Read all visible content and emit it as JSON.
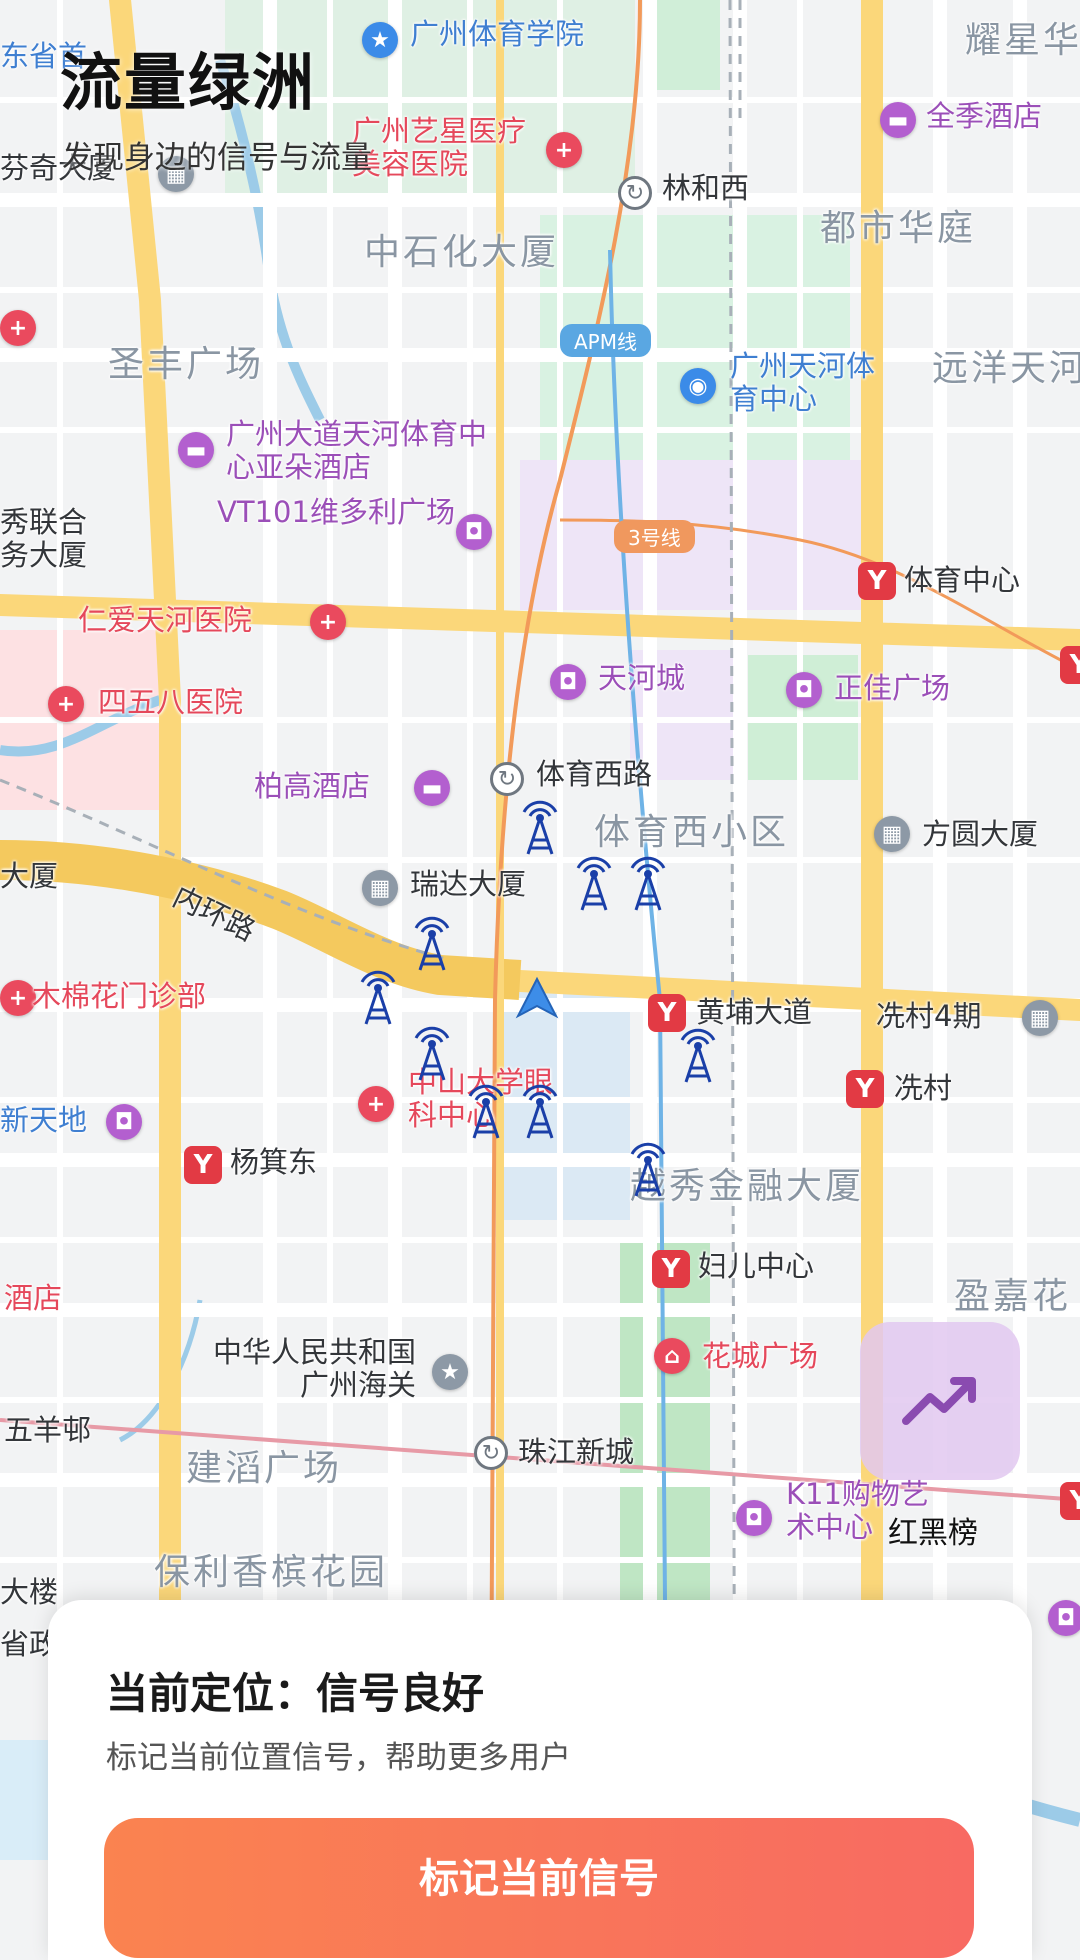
{
  "app": {
    "title": "流量绿洲",
    "subtitle": "发现身边的信号与流量"
  },
  "map": {
    "labels": {
      "guangzhou_sports_institute": "广州体育学院",
      "yaoxing": "耀星华",
      "quanji_hotel": "全季酒店",
      "yixing_hospital": "广州艺星医疗美容医院",
      "linhexi": "林和西",
      "fenqi": "芬奇大厦",
      "dongsheng": "东省首",
      "zhongshihua": "中石化大厦",
      "dushi_huating": "都市华庭",
      "apm_line": "APM线",
      "tianhe_sports_center": "广州天河体育中心",
      "yuanyang": "远洋天河",
      "shengfeng": "圣丰广场",
      "yaduo_hotel": "广州大道天河体育中心亚朵酒店",
      "vt101": "VT101维多利广场",
      "lianhe": "秀联合务大厦",
      "line3": "3号线",
      "tiyu_zhongxin": "体育中心",
      "renai_hospital": "仁爱天河医院",
      "tianhecheng": "天河城",
      "zhengjia": "正佳广场",
      "458_hospital": "四五八医院",
      "baigao_hotel": "柏高酒店",
      "tiyuxilu": "体育西路",
      "tiyuxi_xiaoqu": "体育西小区",
      "fangyuan": "方圆大厦",
      "dasha": "大厦",
      "neihuan": "内环路",
      "ruida": "瑞达大厦",
      "muchmianhua": "木棉花门诊部",
      "huangpu": "黄埔大道",
      "xiancun4": "冼村4期",
      "xiancun": "冼村",
      "zhongshan_eye": "中山大学眼科中心",
      "xintiandi": "新天地",
      "yangjidong": "杨箕东",
      "yuexiu": "越秀金融大厦",
      "fuer": "妇儿中心",
      "jiudian": "酒店",
      "yingjia": "盈嘉花",
      "customs": "中华人民共和国广州海关",
      "huacheng": "花城广场",
      "wuyangcun": "五羊邨",
      "zhujiang": "珠江新城",
      "jiandao": "建滔广场",
      "k11": "K11购物艺术中心",
      "baoli": "保利香槟花园",
      "dalou": "大楼",
      "shengzheng": "省政"
    }
  },
  "ranking": {
    "label": "红黑榜"
  },
  "card": {
    "status_title": "当前定位：信号良好",
    "status_desc": "标记当前位置信号，帮助更多用户",
    "button_label": "标记当前信号"
  },
  "colors": {
    "accent_start": "#fa8350",
    "accent_end": "#f86a62",
    "tower": "#1a3fa8",
    "ranking_bg": "#e2c8f0"
  }
}
